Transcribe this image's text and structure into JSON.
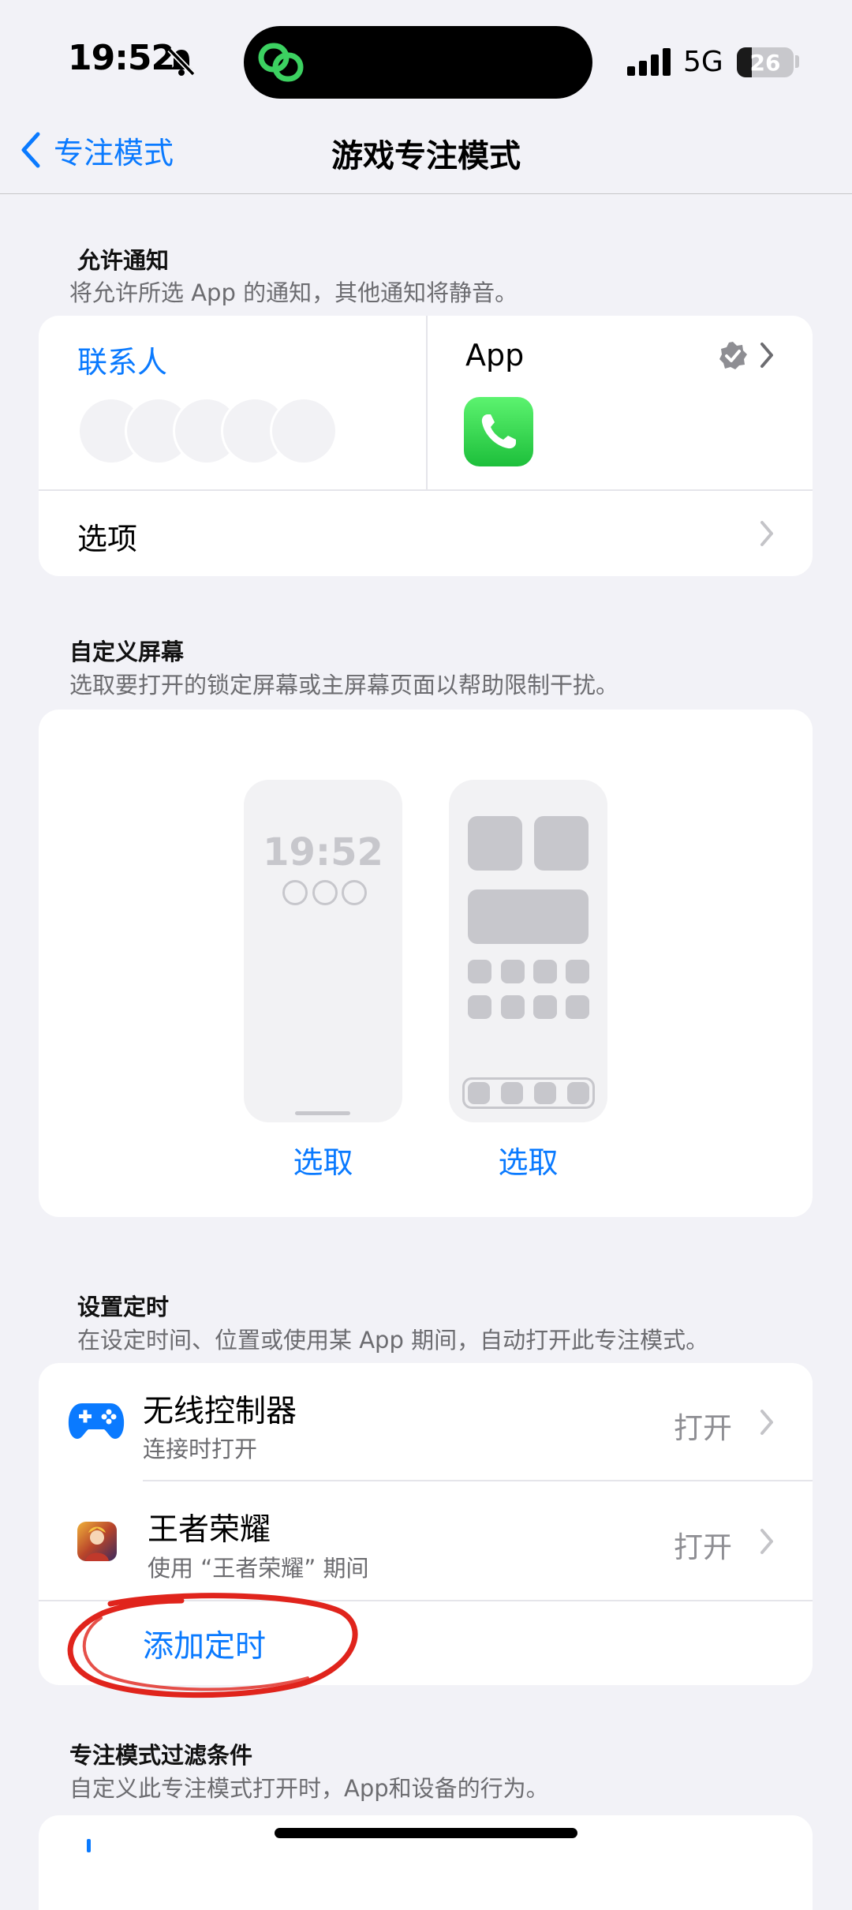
{
  "status_bar": {
    "time": "19:52",
    "network": "5G",
    "battery": "26",
    "battery_level": 0.26
  },
  "nav": {
    "back_label": "专注模式",
    "title": "游戏专注模式"
  },
  "allow_notifications": {
    "title": "允许通知",
    "subtitle": "将允许所选 App 的通知，其他通知将静音。",
    "contacts_label": "联系人",
    "apps_label": "App",
    "options_label": "选项",
    "phone_app_icon": "phone-app-icon"
  },
  "custom_screens": {
    "title": "自定义屏幕",
    "subtitle": "选取要打开的锁定屏幕或主屏幕页面以帮助限制干扰。",
    "lock_screen_time": "19:52",
    "lock_choose": "选取",
    "home_choose": "选取"
  },
  "schedule": {
    "title": "设置定时",
    "subtitle": "在设定时间、位置或使用某 App 期间，自动打开此专注模式。",
    "items": [
      {
        "title": "无线控制器",
        "subtitle": "连接时打开",
        "status": "打开",
        "icon": "gamepad-icon"
      },
      {
        "title": "王者荣耀",
        "subtitle": "使用 “王者荣耀” 期间",
        "status": "打开",
        "icon": "game-app-icon"
      }
    ],
    "add_label": "添加定时"
  },
  "focus_filters": {
    "title": "专注模式过滤条件",
    "subtitle": "自定义此专注模式打开时，App和设备的行为。"
  },
  "colors": {
    "accent": "#0a7aff",
    "background": "#f2f2f7",
    "annotation": "#e0241c",
    "phone_green": "#34c759"
  }
}
